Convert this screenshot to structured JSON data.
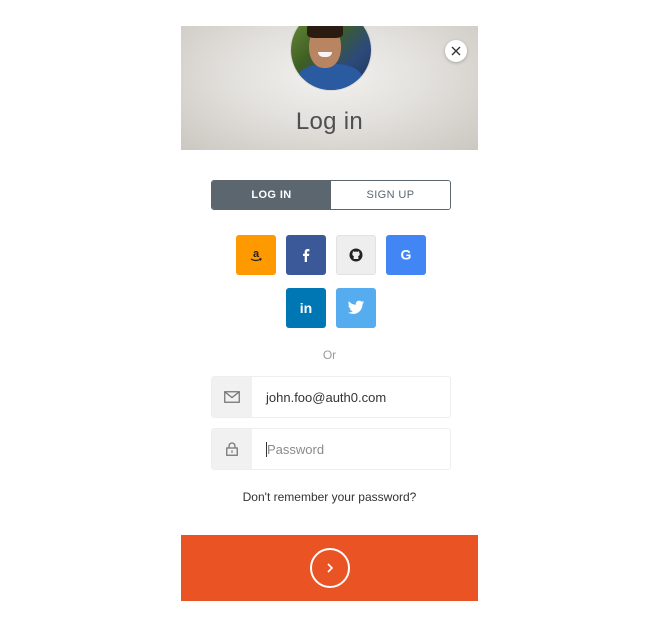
{
  "header": {
    "title": "Log in",
    "close_icon": "close-icon",
    "avatar": "user-avatar"
  },
  "tabs": {
    "login_label": "LOG IN",
    "signup_label": "SIGN UP",
    "active": "login"
  },
  "social": [
    {
      "name": "amazon",
      "icon": "amazon-icon",
      "color": "#ff9900"
    },
    {
      "name": "facebook",
      "icon": "facebook-icon",
      "color": "#3b5998"
    },
    {
      "name": "github",
      "icon": "github-icon",
      "color": "#eeeeee"
    },
    {
      "name": "google",
      "icon": "google-icon",
      "color": "#4285f4"
    },
    {
      "name": "linkedin",
      "icon": "linkedin-icon",
      "color": "#0077b5"
    },
    {
      "name": "twitter",
      "icon": "twitter-icon",
      "color": "#55acee"
    }
  ],
  "separator": "Or",
  "email": {
    "value": "john.foo@auth0.com",
    "icon": "envelope-icon"
  },
  "password": {
    "placeholder": "Password",
    "value": "",
    "icon": "lock-icon"
  },
  "forgot_link": "Don't remember your password?",
  "submit": {
    "icon": "chevron-right-icon",
    "color": "#ea5323"
  }
}
